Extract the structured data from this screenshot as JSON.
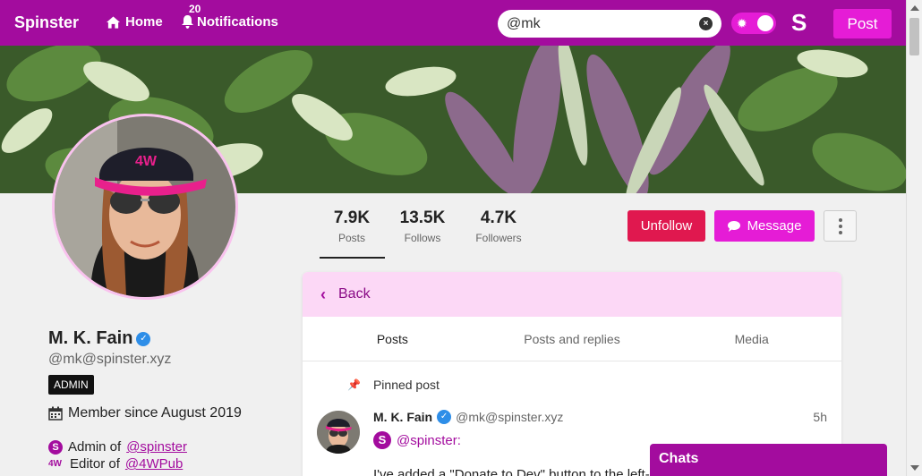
{
  "nav": {
    "brand": "Spinster",
    "home_label": "Home",
    "notifications_label": "Notifications",
    "notifications_count": "20",
    "search_value": "@mk",
    "post_label": "Post",
    "logo_letter": "S"
  },
  "profile": {
    "display_name": "M. K. Fain",
    "handle": "@mk@spinster.xyz",
    "badge": "ADMIN",
    "member_since": "Member since August 2019",
    "roles": [
      {
        "prefix": "Admin of",
        "link": "@spinster"
      },
      {
        "prefix": "Editor of",
        "link": "@4WPub"
      }
    ],
    "stats": [
      {
        "value": "7.9K",
        "label": "Posts"
      },
      {
        "value": "13.5K",
        "label": "Follows"
      },
      {
        "value": "4.7K",
        "label": "Followers"
      }
    ],
    "unfollow_label": "Unfollow",
    "message_label": "Message"
  },
  "timeline": {
    "back_label": "Back",
    "tabs": [
      "Posts",
      "Posts and replies",
      "Media"
    ],
    "pinned_label": "Pinned post",
    "post": {
      "author": "M. K. Fain",
      "handle": "@mk@spinster.xyz",
      "time": "5h",
      "group": "@spinster:",
      "text": "I've added a \"Donate to Dev\" button to the left-hand"
    }
  },
  "chats_label": "Chats",
  "colors": {
    "brand": "#a30c9e",
    "accent": "#e51cd6",
    "unfollow": "#e0184f",
    "verified": "#2e8ee8"
  }
}
